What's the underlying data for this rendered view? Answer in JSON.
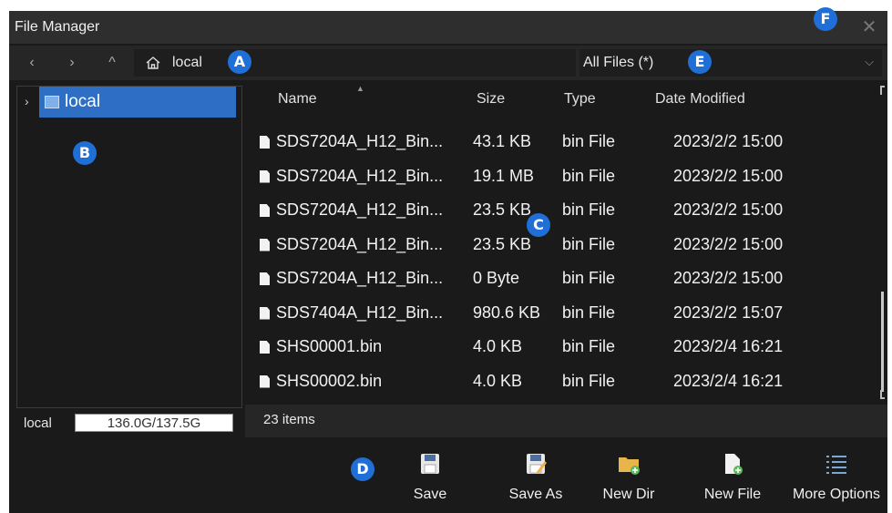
{
  "window": {
    "title": "File Manager",
    "close_glyph": "✕"
  },
  "nav": {
    "back_glyph": "‹",
    "forward_glyph": "›",
    "up_glyph": "^",
    "path": "local",
    "filter": "All Files (*)",
    "filter_chevron": "⌵"
  },
  "tree": {
    "expand_glyph": "›",
    "items": [
      {
        "label": "local",
        "selected": true
      }
    ]
  },
  "storage": {
    "label": "local",
    "usage": "136.0G/137.5G"
  },
  "columns": {
    "name": "Name",
    "size": "Size",
    "type": "Type",
    "date": "Date Modified"
  },
  "files": [
    {
      "name": "SDS7204A_H12_Bin...",
      "size": "43.1 KB",
      "type": "bin File",
      "date": "2023/2/2 15:00"
    },
    {
      "name": "SDS7204A_H12_Bin...",
      "size": "19.1 MB",
      "type": "bin File",
      "date": "2023/2/2 15:00"
    },
    {
      "name": "SDS7204A_H12_Bin...",
      "size": "23.5 KB",
      "type": "bin File",
      "date": "2023/2/2 15:00"
    },
    {
      "name": "SDS7204A_H12_Bin...",
      "size": "23.5 KB",
      "type": "bin File",
      "date": "2023/2/2 15:00"
    },
    {
      "name": "SDS7204A_H12_Bin...",
      "size": "0 Byte",
      "type": "bin File",
      "date": "2023/2/2 15:00"
    },
    {
      "name": "SDS7404A_H12_Bin...",
      "size": "980.6 KB",
      "type": "bin File",
      "date": "2023/2/2 15:07"
    },
    {
      "name": "SHS00001.bin",
      "size": "4.0 KB",
      "type": "bin File",
      "date": "2023/2/4 16:21"
    },
    {
      "name": "SHS00002.bin",
      "size": "4.0 KB",
      "type": "bin File",
      "date": "2023/2/4 16:21"
    }
  ],
  "status": {
    "count": "23 items"
  },
  "toolbar": {
    "save": "Save",
    "save_as": "Save As",
    "new_dir": "New Dir",
    "new_file": "New File",
    "more_options": "More Options"
  },
  "markers": {
    "a": "A",
    "b": "B",
    "c": "C",
    "d": "D",
    "e": "E",
    "f": "F"
  },
  "colors": {
    "accent": "#2e6ec4",
    "marker": "#1f6fd6",
    "background": "#1a1a1a"
  },
  "icons": {
    "home": "home-icon",
    "file": "file-icon",
    "drive": "drive-icon",
    "save": "save-icon",
    "save_as": "save-as-icon",
    "new_dir": "new-folder-icon",
    "new_file": "new-file-icon",
    "more_options": "list-icon"
  }
}
